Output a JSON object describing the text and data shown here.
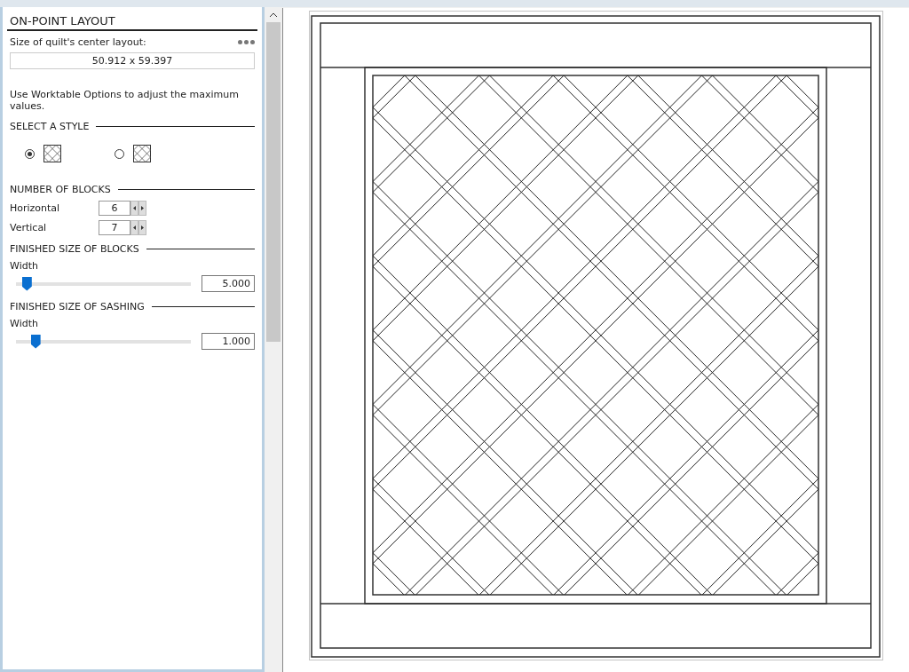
{
  "panel": {
    "title": "ON-POINT LAYOUT",
    "size_label": "Size of quilt's center layout:",
    "size_value": "50.912 x 59.397",
    "note": "Use Worktable Options to adjust the maximum values."
  },
  "style_section": {
    "heading": "SELECT A STYLE",
    "options": [
      {
        "selected": true
      },
      {
        "selected": false
      }
    ]
  },
  "blocks_section": {
    "heading": "NUMBER OF BLOCKS",
    "spinners": [
      {
        "label": "Horizontal",
        "value": "6"
      },
      {
        "label": "Vertical",
        "value": "7"
      }
    ]
  },
  "sliders": [
    {
      "heading": "FINISHED SIZE OF BLOCKS",
      "label": "Width",
      "level": 0.06,
      "value": "5.000"
    },
    {
      "heading": "FINISHED SIZE OF SASHING",
      "label": "Width",
      "level": 0.11,
      "value": "1.000"
    }
  ]
}
